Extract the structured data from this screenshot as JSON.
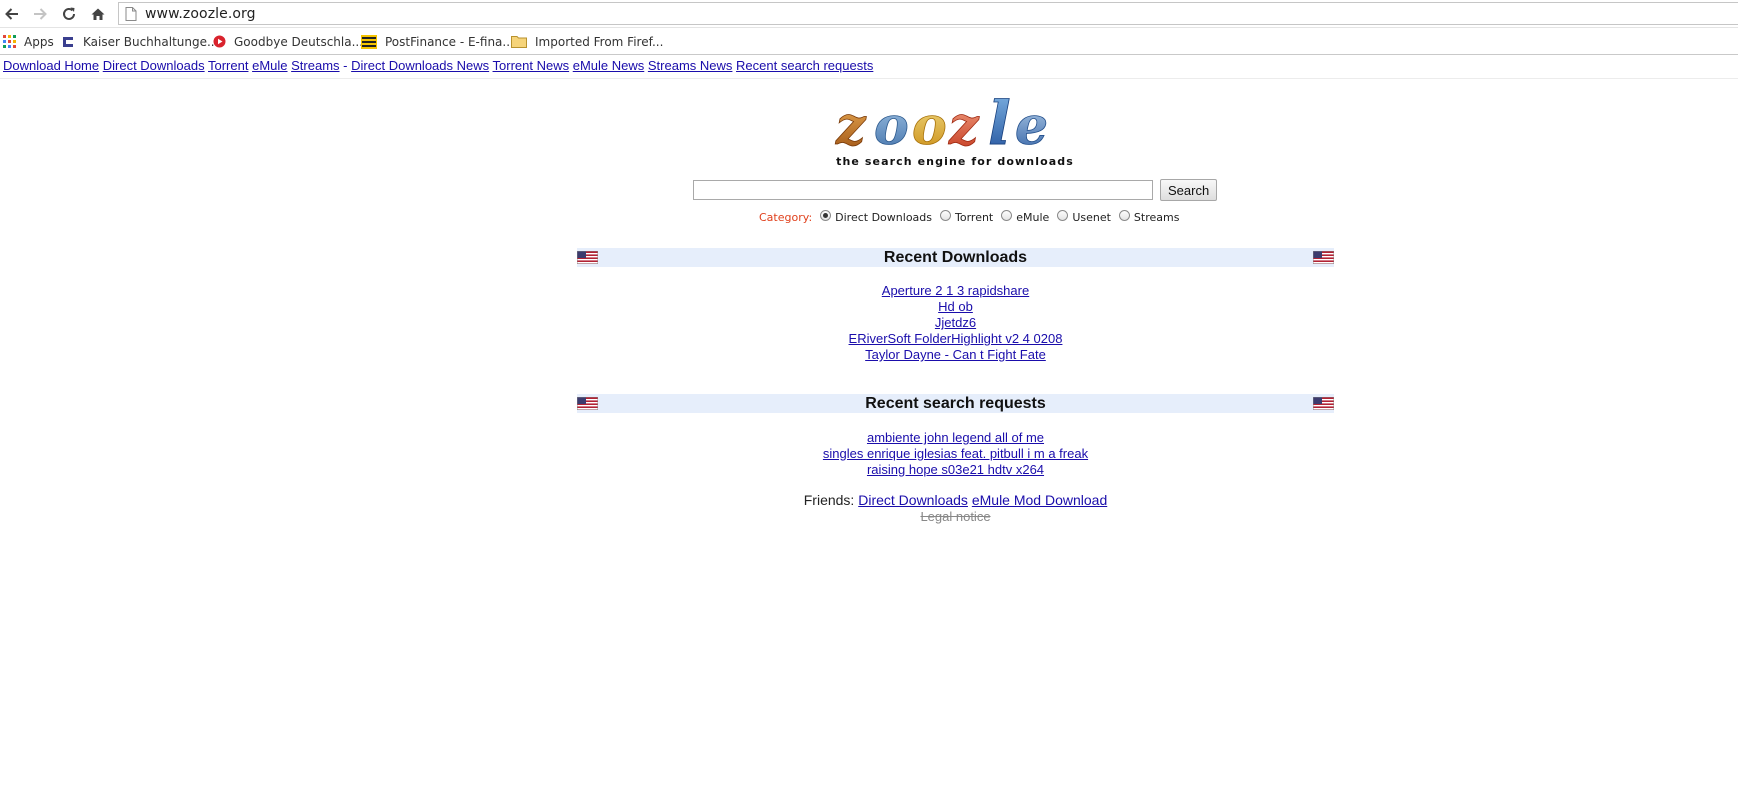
{
  "browser": {
    "url": "www.zoozle.org",
    "bookmarks": [
      {
        "label": "Apps",
        "icon": "apps-grid-icon"
      },
      {
        "label": "Kaiser Buchhaltunge...",
        "icon": "kaiser-favicon"
      },
      {
        "label": "Goodbye Deutschla...",
        "icon": "goodbye-favicon"
      },
      {
        "label": "PostFinance - E-fina...",
        "icon": "postfinance-favicon"
      },
      {
        "label": "Imported From Firef...",
        "icon": "folder-icon"
      }
    ]
  },
  "topnav": [
    "Download Home",
    "Direct Downloads",
    "Torrent",
    "eMule",
    "Streams",
    "-",
    "Direct Downloads News",
    "Torrent News",
    "eMule News",
    "Streams News",
    "Recent search requests"
  ],
  "logo": {
    "text": "zoozle",
    "tagline": "the search engine for downloads"
  },
  "search": {
    "value": "",
    "button_label": "Search"
  },
  "category": {
    "label": "Category:",
    "options": [
      "Direct Downloads",
      "Torrent",
      "eMule",
      "Usenet",
      "Streams"
    ],
    "selected": "Direct Downloads"
  },
  "recent_downloads": {
    "title": "Recent Downloads",
    "items": [
      "Aperture 2 1 3 rapidshare",
      "Hd ob",
      "Jjetdz6",
      "ERiverSoft FolderHighlight v2 4 0208",
      "Taylor Dayne - Can t Fight Fate"
    ]
  },
  "recent_searches": {
    "title": "Recent search requests",
    "items": [
      "ambiente john legend all of me",
      "singles enrique iglesias feat. pitbull i m a freak",
      "raising hope s03e21 hdtv x264"
    ]
  },
  "friends": {
    "label": "Friends:",
    "links": [
      "Direct Downloads",
      "eMule Mod Download"
    ]
  },
  "legal_notice": "Legal notice",
  "colors": {
    "link": "#1a0dab",
    "category_label": "#e0401c",
    "section_bar": "#e6eefb"
  }
}
